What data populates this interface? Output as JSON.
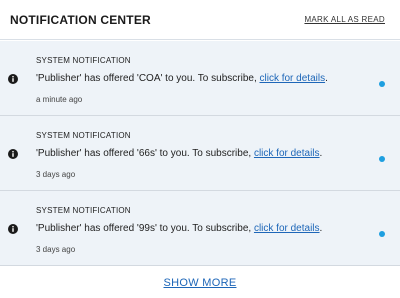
{
  "header": {
    "title": "NOTIFICATION CENTER",
    "mark_all_label": "MARK ALL AS READ"
  },
  "notifications": [
    {
      "category": "SYSTEM NOTIFICATION",
      "message_prefix": "'Publisher' has offered 'COA' to you. To subscribe, ",
      "link_text": "click for details",
      "message_suffix": ".",
      "time": "a minute ago",
      "unread": true,
      "icon": "info-icon"
    },
    {
      "category": "SYSTEM NOTIFICATION",
      "message_prefix": "'Publisher' has offered '66s' to you. To subscribe, ",
      "link_text": "click for details",
      "message_suffix": ".",
      "time": "3 days ago",
      "unread": true,
      "icon": "info-icon"
    },
    {
      "category": "SYSTEM NOTIFICATION",
      "message_prefix": "'Publisher' has offered '99s' to you. To subscribe, ",
      "link_text": "click for details",
      "message_suffix": ".",
      "time": "3 days ago",
      "unread": true,
      "icon": "info-icon"
    }
  ],
  "footer": {
    "show_more_label": "SHOW MORE"
  },
  "colors": {
    "item_background": "#eef3f8",
    "link": "#1d66b8",
    "unread_dot": "#1e9fe0"
  }
}
